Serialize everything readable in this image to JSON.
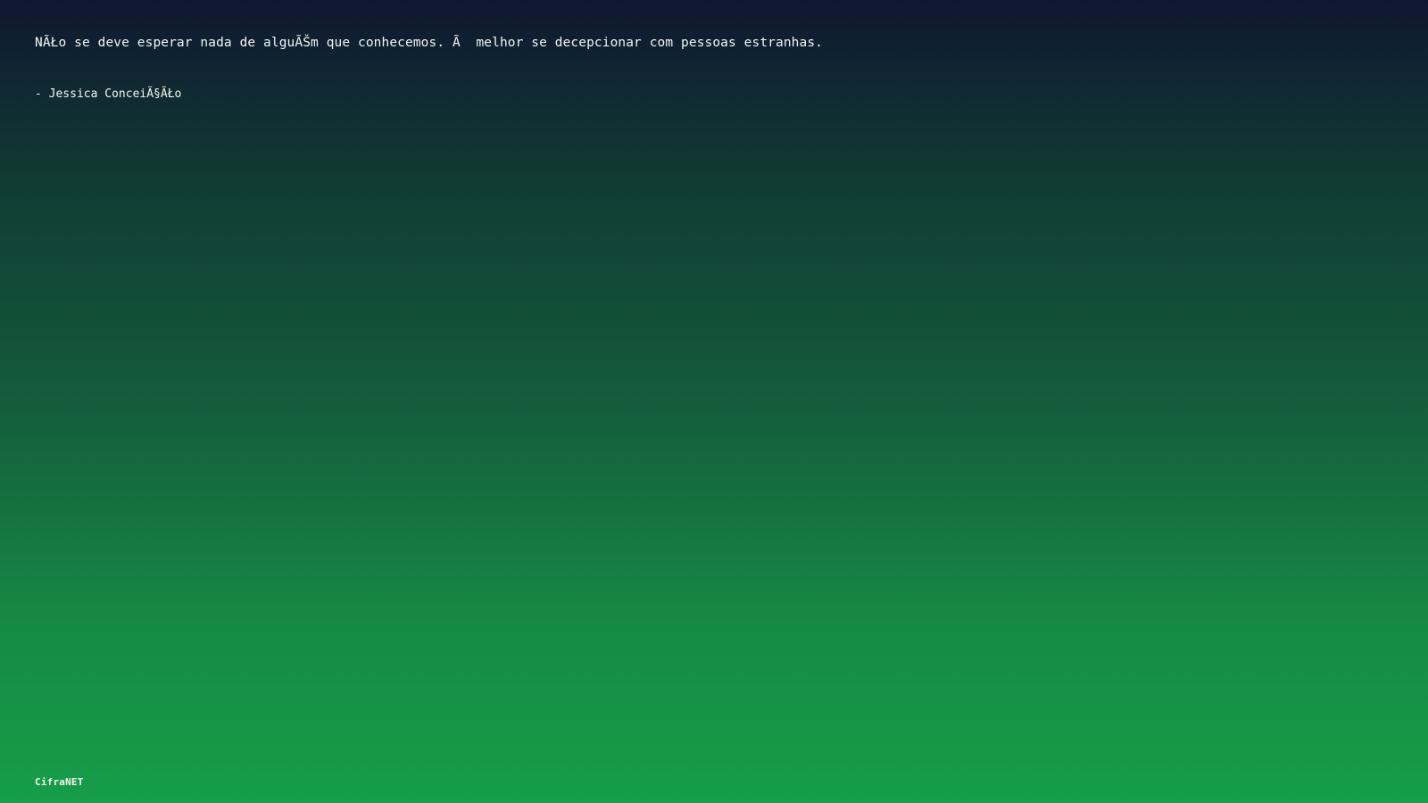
{
  "quote": {
    "text": "NÃŁo se deve esperar nada de alguÃŠm que conhecemos. Ã  melhor se decepcionar com pessoas estranhas.",
    "author": "- Jessica ConceiÃ§ÃŁo"
  },
  "brand": {
    "name": "CifraNET"
  },
  "colors": {
    "gradient_top": "#0f1730",
    "gradient_bottom": "#169e48",
    "text": "#f3f6f2"
  }
}
